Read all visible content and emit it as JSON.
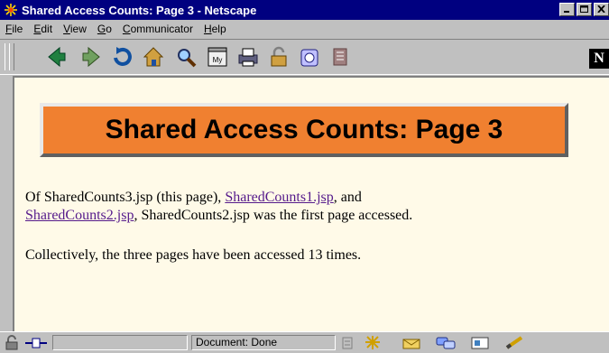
{
  "window": {
    "title": "Shared Access Counts: Page 3 - Netscape"
  },
  "menu": [
    "File",
    "Edit",
    "View",
    "Go",
    "Communicator",
    "Help"
  ],
  "menu_underline": [
    "F",
    "E",
    "V",
    "G",
    "C",
    "H"
  ],
  "toolbar": {
    "icons": [
      "back-icon",
      "forward-icon",
      "reload-icon",
      "home-icon",
      "search-icon",
      "my-netscape-icon",
      "print-icon",
      "security-icon",
      "shop-icon",
      "stop-icon"
    ],
    "logo": "N"
  },
  "page": {
    "heading": "Shared Access Counts: Page 3",
    "para1_before": "Of SharedCounts3.jsp (this page), ",
    "link1": "SharedCounts1.jsp",
    "para1_mid": ", and",
    "link2": "SharedCounts2.jsp",
    "para1_after": ", SharedCounts2.jsp was the first page accessed.",
    "para2": "Collectively, the three pages have been accessed 13 times."
  },
  "status": {
    "text": "Document: Done"
  },
  "colors": {
    "titlebar": "#000080",
    "heading_bg": "#f08030",
    "page_bg": "#fffae8",
    "link": "#551a8b"
  }
}
